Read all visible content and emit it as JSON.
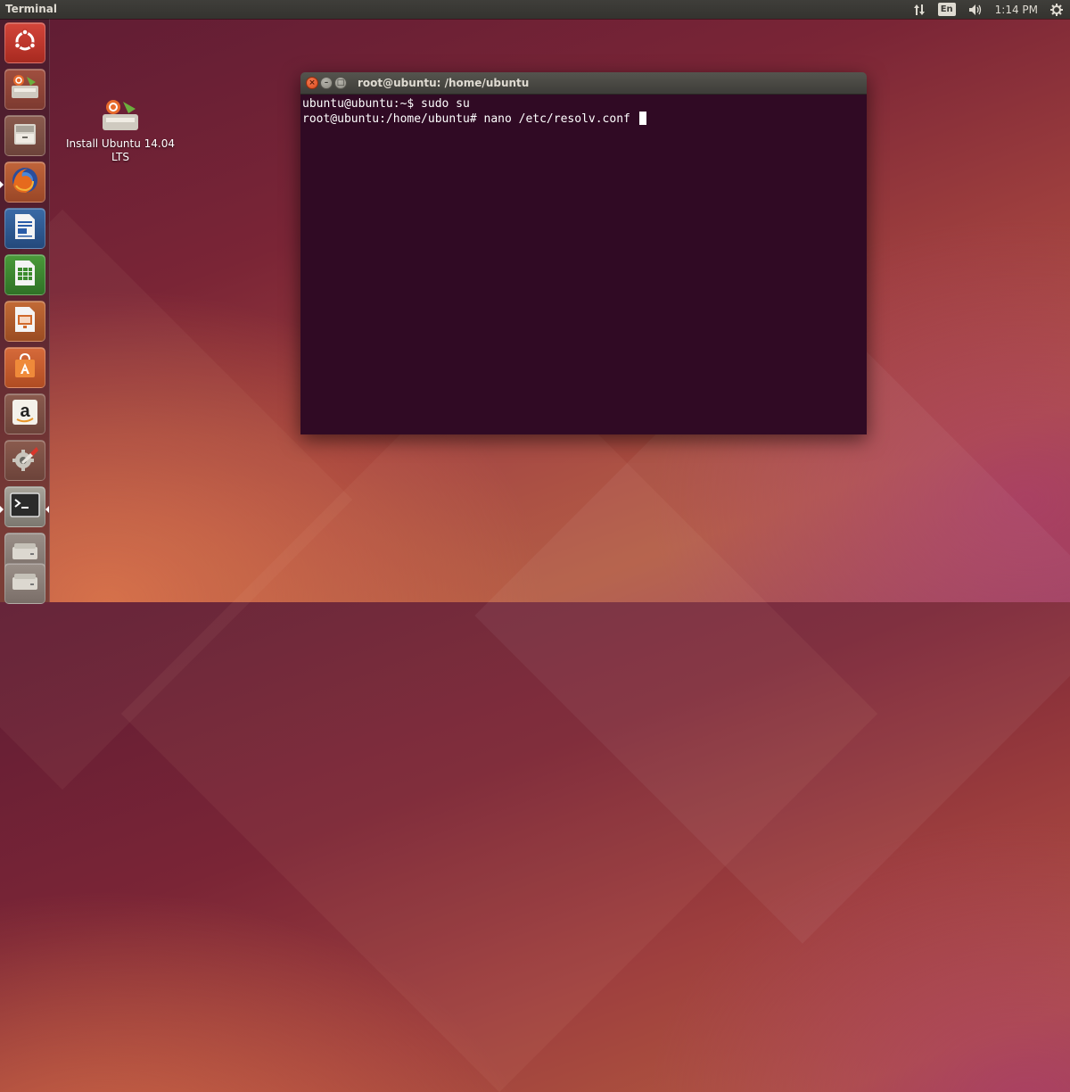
{
  "top_panel": {
    "app_title": "Terminal",
    "language": "En",
    "clock": "1:14 PM",
    "icons": [
      "network-arrows-icon",
      "keyboard-language-icon",
      "volume-icon",
      "session-gear-icon"
    ]
  },
  "launcher": {
    "items": [
      {
        "name": "dash-home",
        "icon": "ubuntu-logo-icon"
      },
      {
        "name": "install-ubuntu",
        "icon": "installer-icon"
      },
      {
        "name": "files",
        "icon": "file-cabinet-icon"
      },
      {
        "name": "firefox",
        "icon": "firefox-icon"
      },
      {
        "name": "libreoffice-writer",
        "icon": "writer-document-icon"
      },
      {
        "name": "libreoffice-calc",
        "icon": "calc-spreadsheet-icon"
      },
      {
        "name": "libreoffice-impress",
        "icon": "impress-presentation-icon"
      },
      {
        "name": "ubuntu-software-center",
        "icon": "shopping-bag-icon"
      },
      {
        "name": "amazon",
        "icon": "amazon-icon"
      },
      {
        "name": "system-settings",
        "icon": "settings-wrench-icon"
      },
      {
        "name": "terminal",
        "icon": "terminal-icon"
      },
      {
        "name": "drive-1",
        "icon": "drive-icon"
      },
      {
        "name": "drive-2",
        "icon": "drive-icon"
      }
    ]
  },
  "desktop": {
    "install_icon_label": "Install Ubuntu 14.04 LTS"
  },
  "terminal": {
    "title": "root@ubuntu: /home/ubuntu",
    "lines": [
      "ubuntu@ubuntu:~$ sudo su",
      "root@ubuntu:/home/ubuntu# nano /etc/resolv.conf "
    ]
  },
  "colors": {
    "terminal_bg": "#300a24",
    "panel_bg": "#3c3b37",
    "close_button": "#e55b26"
  }
}
